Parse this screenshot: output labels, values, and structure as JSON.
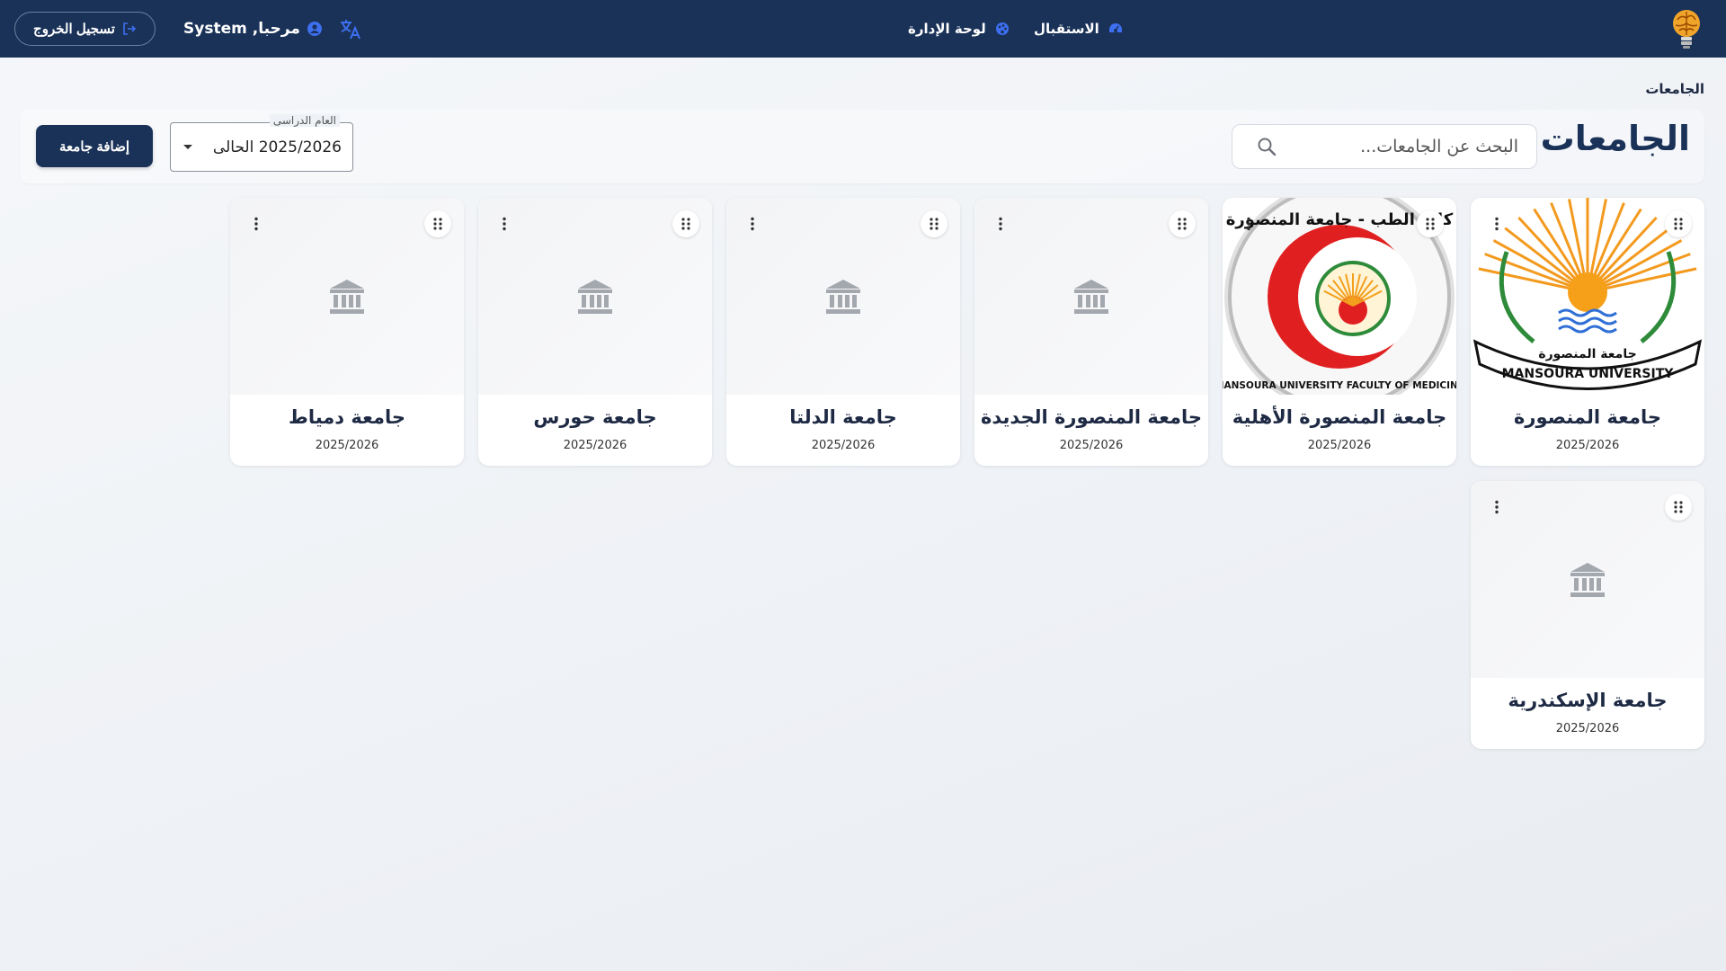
{
  "nav": {
    "home_label": "الاستقبال",
    "admin_label": "لوحة الإدارة",
    "greeting": "مرحبا, System",
    "logout_label": "تسجيل الخروج"
  },
  "breadcrumb": "الجامعات",
  "page": {
    "title": "الجامعات",
    "search_placeholder": "البحث عن الجامعات...",
    "year_select": {
      "legend": "العام الدراسى",
      "value": "2025/2026 الحالى"
    },
    "add_button": "إضافة جامعة"
  },
  "universities": [
    {
      "name": "جامعة المنصورة",
      "year": "2025/2026",
      "has_logo": true,
      "logo_text": "جامعة المنصورة",
      "logo_text_en": "MANSOURA UNIVERSITY"
    },
    {
      "name": "جامعة المنصورة الأهلية",
      "year": "2025/2026",
      "has_logo": true,
      "logo_text": "كلية الطب - جامعة المنصورة",
      "logo_text_en": "MANSOURA UNIVERSITY FACULTY OF MEDICINE"
    },
    {
      "name": "جامعة المنصورة الجديدة",
      "year": "2025/2026",
      "has_logo": false
    },
    {
      "name": "جامعة الدلتا",
      "year": "2025/2026",
      "has_logo": false
    },
    {
      "name": "جامعة حورس",
      "year": "2025/2026",
      "has_logo": false
    },
    {
      "name": "جامعة دمياط",
      "year": "2025/2026",
      "has_logo": false
    },
    {
      "name": "جامعة الإسكندرية",
      "year": "2025/2026",
      "has_logo": false
    }
  ],
  "colors": {
    "topbar": "#1a3258",
    "accent_icon": "#3d6ff0",
    "primary_button": "#1a3258"
  },
  "icons": {
    "logo": "brain-lightbulb-icon",
    "home": "dashboard-gauge-icon",
    "admin": "admin-palette-icon",
    "translate": "translate-icon",
    "user": "account-circle-icon",
    "logout": "logout-icon",
    "search": "search-icon",
    "card_placeholder": "bank-building-icon",
    "card_drag": "drag-handle-icon",
    "card_menu": "more-vert-icon"
  }
}
